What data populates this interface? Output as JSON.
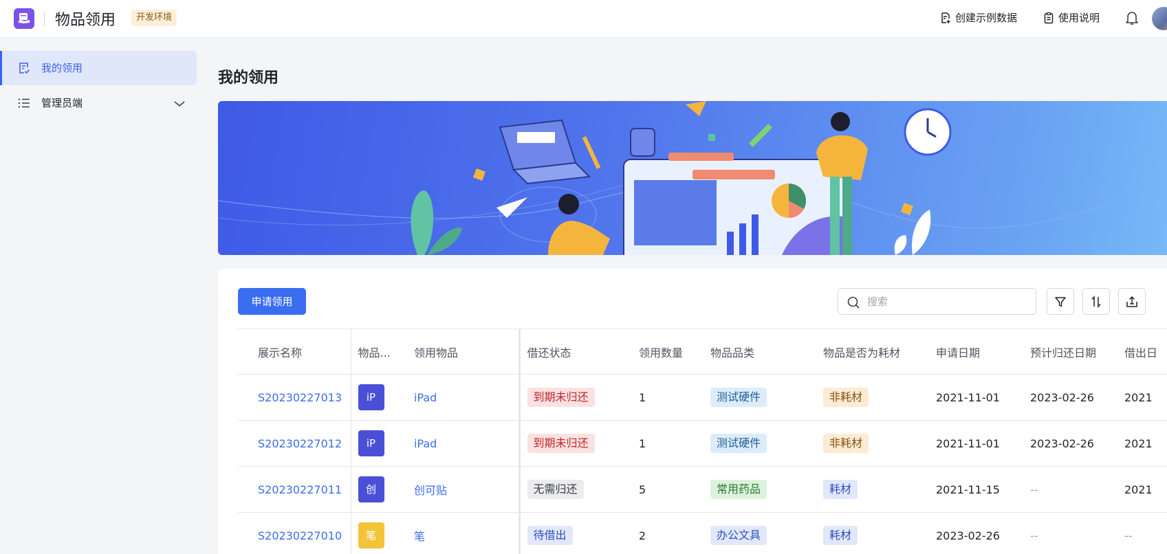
{
  "header": {
    "app_title": "物品领用",
    "env_badge": "开发环境",
    "actions": [
      {
        "label": "创建示例数据",
        "icon": "create-data-icon"
      },
      {
        "label": "使用说明",
        "icon": "clipboard-icon"
      }
    ],
    "bell_icon": "bell-icon"
  },
  "sidebar": {
    "items": [
      {
        "label": "我的领用",
        "icon": "my-requests-icon",
        "active": true
      },
      {
        "label": "管理员端",
        "icon": "list-icon",
        "expandable": true
      }
    ]
  },
  "main": {
    "page_title": "我的领用",
    "apply_button": "申请领用",
    "search_placeholder": "搜索",
    "tool_icons": [
      "filter-icon",
      "sort-icon",
      "export-icon"
    ]
  },
  "table": {
    "columns": [
      "展示名称",
      "物品...",
      "领用物品",
      "借还状态",
      "领用数量",
      "物品品类",
      "物品是否为耗材",
      "申请日期",
      "预计归还日期",
      "借出日"
    ],
    "rows": [
      {
        "id": "S20230227013",
        "icon_text": "iP",
        "icon_color": "#4a4fd8",
        "item": "iPad",
        "status": "到期未归还",
        "status_type": "overdue",
        "qty": "1",
        "category": "测试硬件",
        "category_type": "hw",
        "consumable": "非耗材",
        "consumable_type": "nonconsum",
        "apply_date": "2021-11-01",
        "return_date": "2023-02-26",
        "lend_date": "2021"
      },
      {
        "id": "S20230227012",
        "icon_text": "iP",
        "icon_color": "#4a4fd8",
        "item": "iPad",
        "status": "到期未归还",
        "status_type": "overdue",
        "qty": "1",
        "category": "测试硬件",
        "category_type": "hw",
        "consumable": "非耗材",
        "consumable_type": "nonconsum",
        "apply_date": "2021-11-01",
        "return_date": "2023-02-26",
        "lend_date": "2021"
      },
      {
        "id": "S20230227011",
        "icon_text": "创",
        "icon_color": "#4a4fd8",
        "item": "创可贴",
        "status": "无需归还",
        "status_type": "noreturn",
        "qty": "5",
        "category": "常用药品",
        "category_type": "med",
        "consumable": "耗材",
        "consumable_type": "consum",
        "apply_date": "2021-11-15",
        "return_date": "--",
        "lend_date": "2021"
      },
      {
        "id": "S20230227010",
        "icon_text": "笔",
        "icon_color": "#f3c33a",
        "item": "笔",
        "status": "待借出",
        "status_type": "pending",
        "qty": "2",
        "category": "办公文具",
        "category_type": "office",
        "consumable": "耗材",
        "consumable_type": "consum",
        "apply_date": "2023-02-26",
        "return_date": "--",
        "lend_date": "--"
      }
    ]
  }
}
